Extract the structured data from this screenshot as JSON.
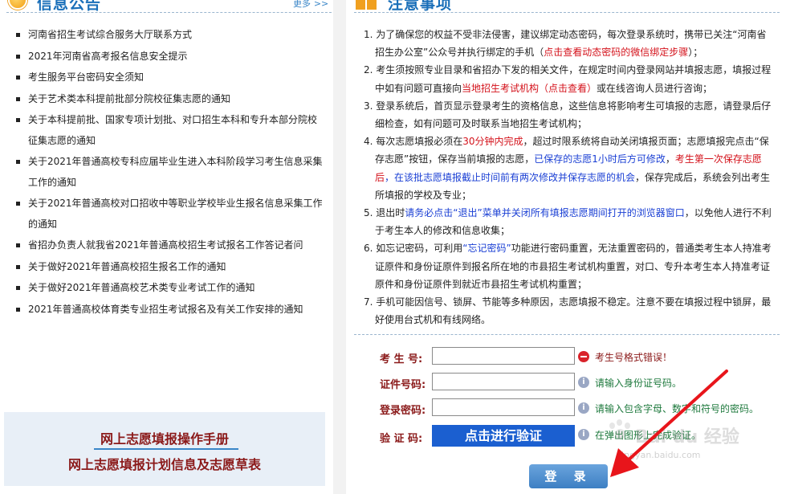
{
  "left": {
    "section_title": "信息公告",
    "more_label": "更多",
    "more_arrows": ">>",
    "notices": [
      "河南省招生考试综合服务大厅联系方式",
      "2021年河南省高考报名信息安全提示",
      "考生服务平台密码安全须知",
      "关于艺术类本科提前批部分院校征集志愿的通知",
      "关于本科提前批、国家专项计划批、对口招生本科和专升本部分院校征集志愿的通知",
      "关于2021年普通高校专科应届毕业生进入本科阶段学习考生信息采集工作的通知",
      "关于2021年普通高校对口招收中等职业学校毕业生报名信息采集工作的通知",
      "省招办负责人就我省2021年普通高校招生考试报名工作答记者问",
      "关于做好2021年普通高校招生报名工作的通知",
      "关于做好2021年普通高校艺术类专业考试工作的通知",
      "2021年普通高校体育类专业招生考试报名及有关工作安排的通知"
    ],
    "manual_link": "网上志愿填报操作手册",
    "plan_link": "网上志愿填报计划信息及志愿草表"
  },
  "right": {
    "section_title": "注意事项",
    "notes": {
      "n1_a": "1. 为了确保您的权益不受非法侵害，建议绑定动态密码，每次登录系统时，携带已关注“河南省招生办公室”公众号并执行绑定的手机（",
      "n1_red": "点击查看动态密码的微信绑定步骤",
      "n1_b": "）；",
      "n2_a": "2. 考生须按照专业目录和省招办下发的相关文件，在规定时间内登录网站并填报志愿，填报过程中如有问题可直接向",
      "n2_red": "当地招生考试机构（点击查看）",
      "n2_b": "或在线咨询人员进行咨询；",
      "n3": "3. 登录系统后，首页显示登录考生的资格信息，这些信息将影响考生可填报的志愿，请登录后仔细检查，如有问题可及时联系当地招生考试机构；",
      "n4_a": "4. 每次志愿填报必须在",
      "n4_red1": "30分钟内完成",
      "n4_b": "，超过时限系统将自动关闭填报页面；志愿填报完点击“保存志愿”按钮，保存当前填报的志愿，",
      "n4_blue1": "已保存的志愿1小时后方可修改",
      "n4_c": "，",
      "n4_red2": "考生第一次保存志愿后",
      "n4_blue2": "，在该批志愿填报截止时间前有两次修改并保存志愿的机会",
      "n4_d": "，保存完成后，系统会列出考生所填报的学校及专业；",
      "n5_a": "5. 退出时",
      "n5_red": "请务必点击“退出”菜单并关闭所有填报志愿期间打开的浏览器窗口",
      "n5_b": "，以免他人进行不利于考生本人的修改和信息收集；",
      "n6_a": "6. 如忘记密码，可利用",
      "n6_red": "“忘记密码”",
      "n6_b": "功能进行密码重置，无法重置密码的，普通类考生本人持准考证原件和身份证原件到报名所在地的市县招生考试机构重置，对口、专升本考生本人持准考证原件和身份证原件到就近市县招生考试机构重置；",
      "n7": "7. 手机可能因信号、锁屏、节能等多种原因，志愿填报不稳定。注意不要在填报过程中锁屏，最好使用台式机和有线网络。"
    },
    "form": {
      "exam_no_label": "考 生 号:",
      "exam_no_value": "",
      "exam_no_hint": "考生号格式错误！",
      "id_label": "证件号码:",
      "id_value": "",
      "id_hint": "请输入身份证号码。",
      "pwd_label": "登录密码:",
      "pwd_value": "",
      "pwd_hint": "请输入包含字母、数字和符号的密码。",
      "captcha_label": "验 证 码:",
      "verify_button": "点击进行验证",
      "captcha_hint": "在弹出图形上完成验证。",
      "login_button": "登 录"
    },
    "watermark": {
      "text": "Bai du 经验",
      "url": "jingyan.baidu.com"
    }
  },
  "colors": {
    "title_blue": "#1a6fb9",
    "label_dark_red": "#8b1a1a",
    "highlight_red": "#d4121b",
    "highlight_blue": "#1a3fd4",
    "button_blue": "#1b5fd0",
    "annotation_arrow": "#e8151b"
  }
}
